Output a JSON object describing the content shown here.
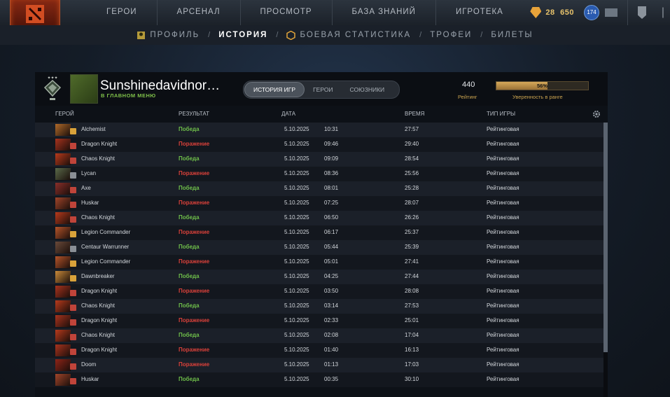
{
  "nav": {
    "items": [
      "ГЕРОИ",
      "АРСЕНАЛ",
      "ПРОСМОТР",
      "БАЗА ЗНАНИЙ",
      "ИГРОТЕКА"
    ],
    "shards_top": "28",
    "shards": "650",
    "notification_count": "174"
  },
  "subnav": {
    "profile": "ПРОФИЛЬ",
    "history": "ИСТОРИЯ",
    "stats": "БОЕВАЯ СТАТИСТИКА",
    "trophies": "ТРОФЕИ",
    "tickets": "БИЛЕТЫ",
    "sep": "/"
  },
  "profile": {
    "name": "Sunshinedavidnor…",
    "status": "В ГЛАВНОМ МЕНЮ",
    "rating": "440",
    "rating_label": "Рейтинг",
    "confidence": "56%",
    "confidence_value": 56,
    "confidence_label": "Уверенность в ранге"
  },
  "tabs": [
    "ИСТОРИЯ ИГР",
    "ГЕРОИ",
    "СОЮЗНИКИ"
  ],
  "columns": {
    "hero": "ГЕРОЙ",
    "result": "РЕЗУЛЬТАТ",
    "date": "ДАТА",
    "duration": "ВРЕМЯ",
    "type": "ТИП ИГРЫ"
  },
  "colors": {
    "win": "#6fbf4a",
    "loss": "#d9413a",
    "accent": "#c9a24f"
  },
  "matches": [
    {
      "hero": "Alchemist",
      "result": "Победа",
      "win": true,
      "date": "5.10.2025",
      "time": "10:31",
      "duration": "27:57",
      "type": "Рейтинговая",
      "hue": "#b06a2a",
      "attr": "#d9a23a"
    },
    {
      "hero": "Dragon Knight",
      "result": "Поражение",
      "win": false,
      "date": "5.10.2025",
      "time": "09:46",
      "duration": "29:40",
      "type": "Рейтинговая",
      "hue": "#a8331e",
      "attr": "#c0443a"
    },
    {
      "hero": "Chaos Knight",
      "result": "Победа",
      "win": true,
      "date": "5.10.2025",
      "time": "09:09",
      "duration": "28:54",
      "type": "Рейтинговая",
      "hue": "#b83a1c",
      "attr": "#c0443a"
    },
    {
      "hero": "Lycan",
      "result": "Поражение",
      "win": false,
      "date": "5.10.2025",
      "time": "08:36",
      "duration": "25:56",
      "type": "Рейтинговая",
      "hue": "#5a6a4a",
      "attr": "#8a8f96"
    },
    {
      "hero": "Axe",
      "result": "Победа",
      "win": true,
      "date": "5.10.2025",
      "time": "08:01",
      "duration": "25:28",
      "type": "Рейтинговая",
      "hue": "#8a2f2a",
      "attr": "#c0443a"
    },
    {
      "hero": "Huskar",
      "result": "Поражение",
      "win": false,
      "date": "5.10.2025",
      "time": "07:25",
      "duration": "28:07",
      "type": "Рейтинговая",
      "hue": "#a1452a",
      "attr": "#c0443a"
    },
    {
      "hero": "Chaos Knight",
      "result": "Победа",
      "win": true,
      "date": "5.10.2025",
      "time": "06:50",
      "duration": "26:26",
      "type": "Рейтинговая",
      "hue": "#b83a1c",
      "attr": "#c0443a"
    },
    {
      "hero": "Legion Commander",
      "result": "Поражение",
      "win": false,
      "date": "5.10.2025",
      "time": "06:17",
      "duration": "25:37",
      "type": "Рейтинговая",
      "hue": "#b5542a",
      "attr": "#d9a23a"
    },
    {
      "hero": "Centaur Warrunner",
      "result": "Победа",
      "win": true,
      "date": "5.10.2025",
      "time": "05:44",
      "duration": "25:39",
      "type": "Рейтинговая",
      "hue": "#6a4a3a",
      "attr": "#8a8f96"
    },
    {
      "hero": "Legion Commander",
      "result": "Поражение",
      "win": false,
      "date": "5.10.2025",
      "time": "05:01",
      "duration": "27:41",
      "type": "Рейтинговая",
      "hue": "#b5542a",
      "attr": "#d9a23a"
    },
    {
      "hero": "Dawnbreaker",
      "result": "Победа",
      "win": true,
      "date": "5.10.2025",
      "time": "04:25",
      "duration": "27:44",
      "type": "Рейтинговая",
      "hue": "#c98a3a",
      "attr": "#d9a23a"
    },
    {
      "hero": "Dragon Knight",
      "result": "Поражение",
      "win": false,
      "date": "5.10.2025",
      "time": "03:50",
      "duration": "28:08",
      "type": "Рейтинговая",
      "hue": "#a8331e",
      "attr": "#c0443a"
    },
    {
      "hero": "Chaos Knight",
      "result": "Победа",
      "win": true,
      "date": "5.10.2025",
      "time": "03:14",
      "duration": "27:53",
      "type": "Рейтинговая",
      "hue": "#b83a1c",
      "attr": "#c0443a"
    },
    {
      "hero": "Dragon Knight",
      "result": "Поражение",
      "win": false,
      "date": "5.10.2025",
      "time": "02:33",
      "duration": "25:01",
      "type": "Рейтинговая",
      "hue": "#a8331e",
      "attr": "#c0443a"
    },
    {
      "hero": "Chaos Knight",
      "result": "Победа",
      "win": true,
      "date": "5.10.2025",
      "time": "02:08",
      "duration": "17:04",
      "type": "Рейтинговая",
      "hue": "#b83a1c",
      "attr": "#c0443a"
    },
    {
      "hero": "Dragon Knight",
      "result": "Поражение",
      "win": false,
      "date": "5.10.2025",
      "time": "01:40",
      "duration": "16:13",
      "type": "Рейтинговая",
      "hue": "#a8331e",
      "attr": "#c0443a"
    },
    {
      "hero": "Doom",
      "result": "Поражение",
      "win": false,
      "date": "5.10.2025",
      "time": "01:13",
      "duration": "17:03",
      "type": "Рейтинговая",
      "hue": "#8f2418",
      "attr": "#c0443a"
    },
    {
      "hero": "Huskar",
      "result": "Победа",
      "win": true,
      "date": "5.10.2025",
      "time": "00:35",
      "duration": "30:10",
      "type": "Рейтинговая",
      "hue": "#a1452a",
      "attr": "#c0443a"
    }
  ]
}
